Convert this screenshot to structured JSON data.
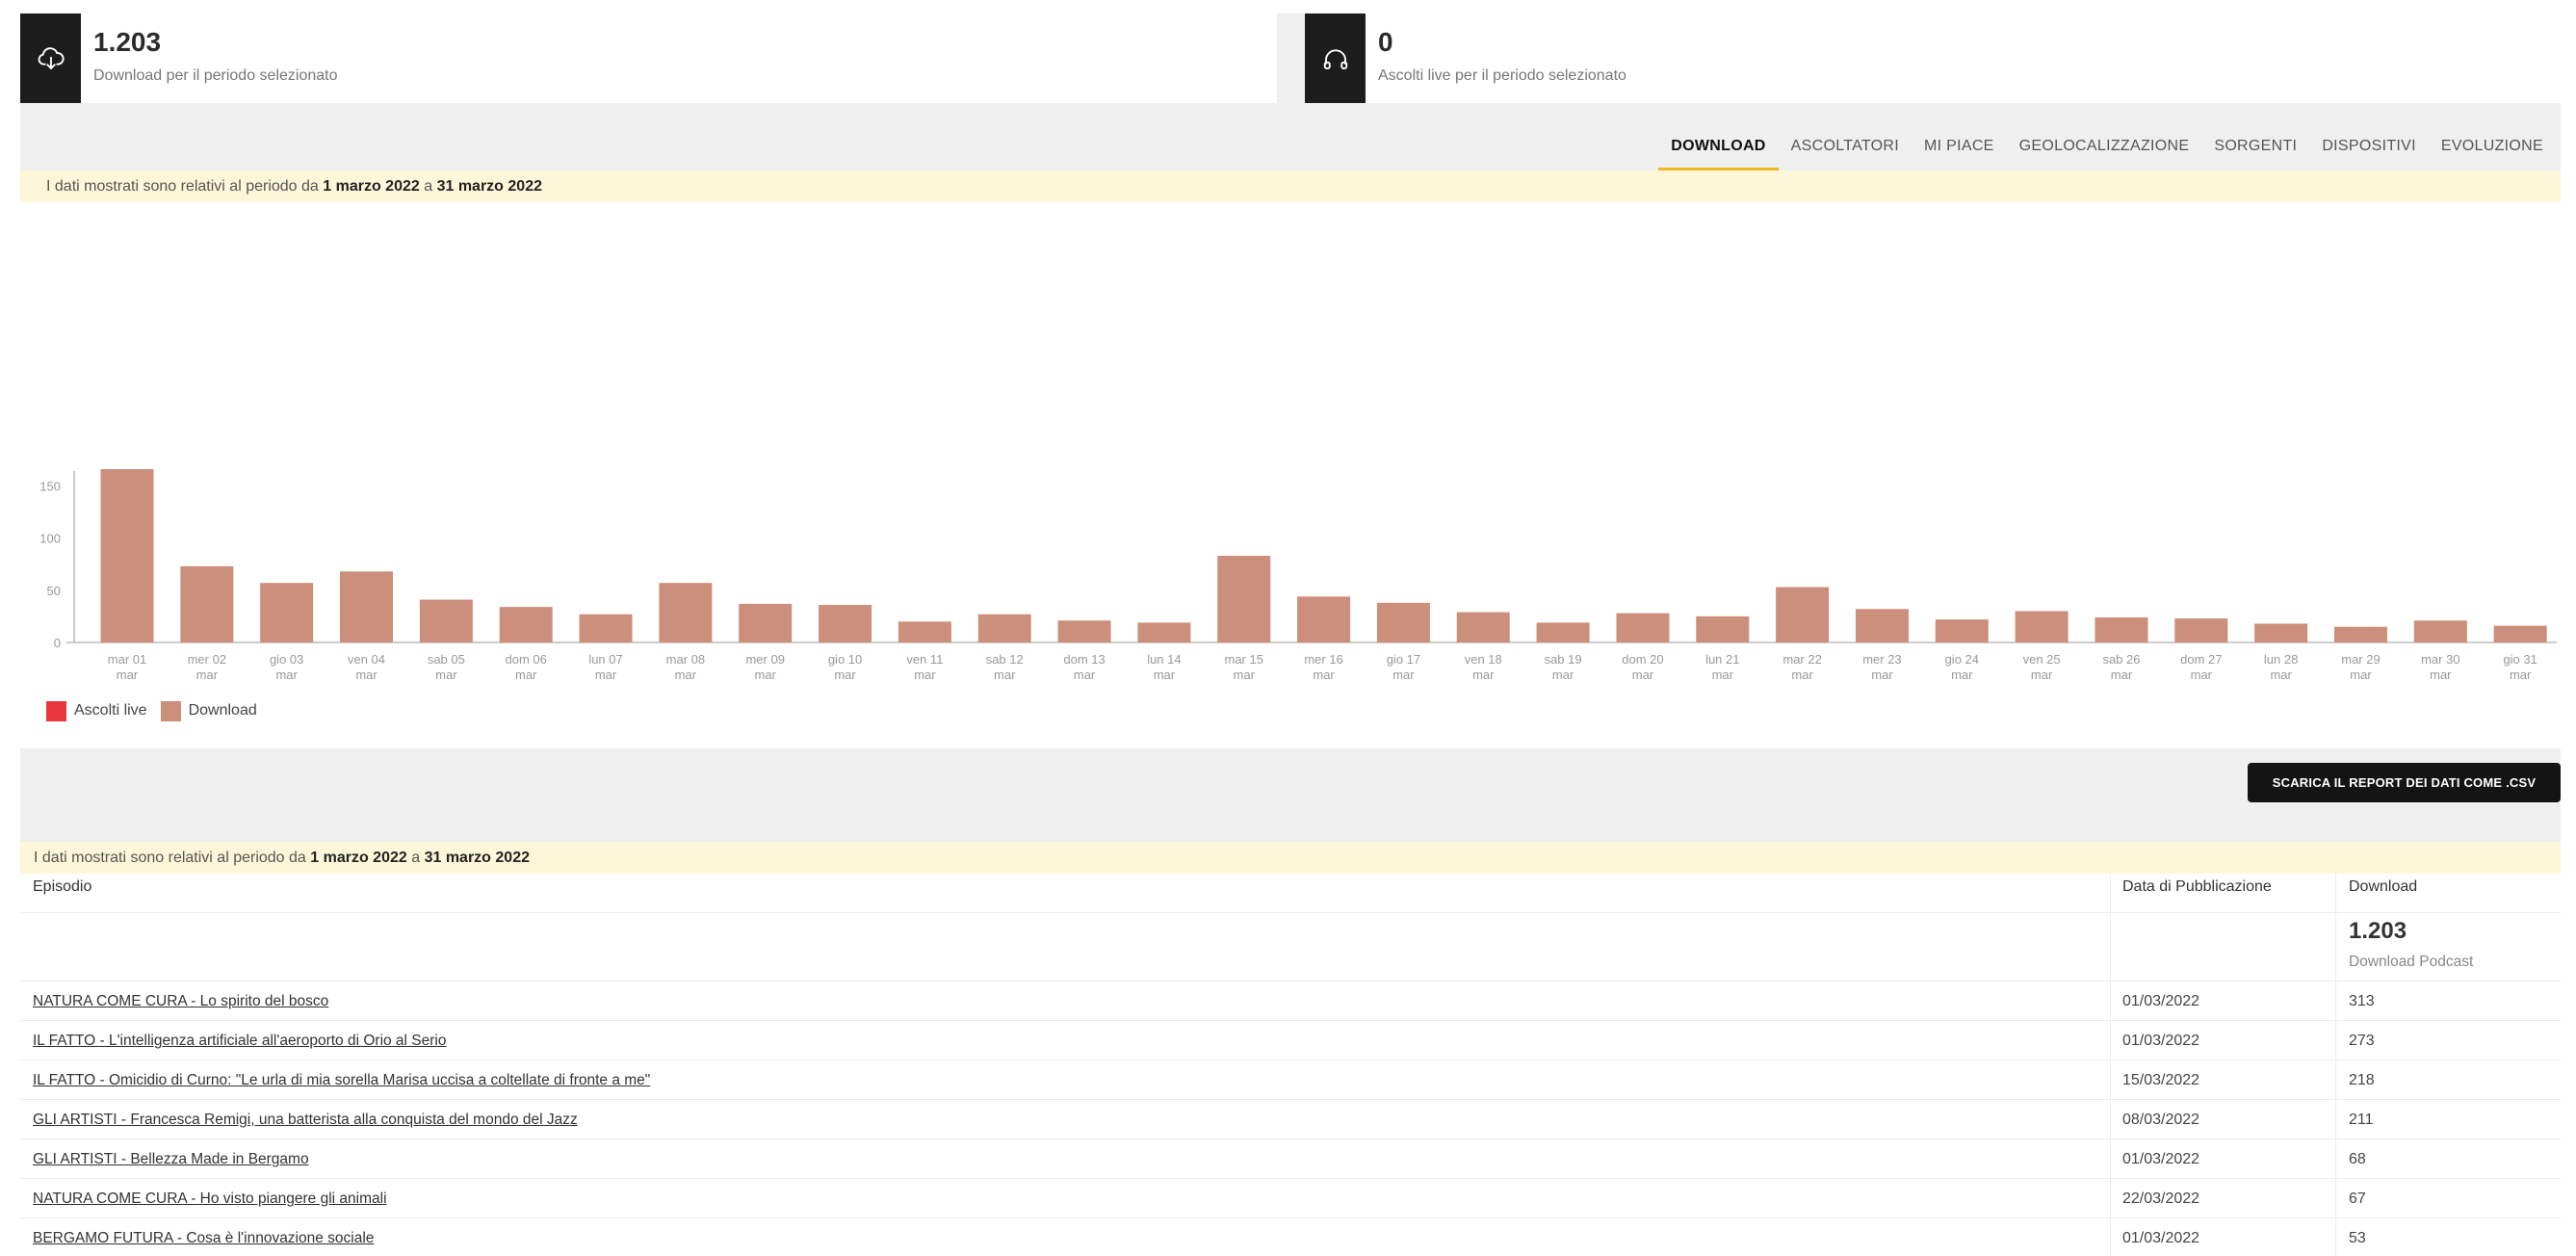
{
  "stats": {
    "downloads": {
      "value": "1.203",
      "label": "Download per il periodo selezionato",
      "icon": "cloud-download-icon"
    },
    "live": {
      "value": "0",
      "label": "Ascolti live per il periodo selezionato",
      "icon": "headphones-icon"
    }
  },
  "tabs": [
    {
      "label": "DOWNLOAD",
      "active": true
    },
    {
      "label": "ASCOLTATORI",
      "active": false
    },
    {
      "label": "MI PIACE",
      "active": false
    },
    {
      "label": "GEOLOCALIZZAZIONE",
      "active": false
    },
    {
      "label": "SORGENTI",
      "active": false
    },
    {
      "label": "DISPOSITIVI",
      "active": false
    },
    {
      "label": "EVOLUZIONE",
      "active": false
    }
  ],
  "notice": {
    "prefix": "I dati mostrati sono relativi al periodo da ",
    "from": "1 marzo 2022",
    "middle": " a ",
    "to": "31 marzo 2022"
  },
  "chart_data": {
    "type": "bar",
    "categories": [
      "mar 01",
      "mer 02",
      "gio 03",
      "ven 04",
      "sab 05",
      "dom 06",
      "lun 07",
      "mar 08",
      "mer 09",
      "gio 10",
      "ven 11",
      "sab 12",
      "dom 13",
      "lun 14",
      "mar 15",
      "mer 16",
      "gio 17",
      "ven 18",
      "sab 19",
      "dom 20",
      "lun 21",
      "mar 22",
      "mer 23",
      "gio 24",
      "ven 25",
      "sab 26",
      "dom 27",
      "lun 28",
      "mar 29",
      "mar 30",
      "gio 31"
    ],
    "category_sublabel": "mar",
    "series": [
      {
        "name": "Ascolti live",
        "color": "#e8383d",
        "values": [
          0,
          0,
          0,
          0,
          0,
          0,
          0,
          0,
          0,
          0,
          0,
          0,
          0,
          0,
          0,
          0,
          0,
          0,
          0,
          0,
          0,
          0,
          0,
          0,
          0,
          0,
          0,
          0,
          0,
          0,
          0
        ]
      },
      {
        "name": "Download",
        "color": "#cc8f7b",
        "values": [
          166,
          73,
          57,
          68,
          41,
          34,
          27,
          57,
          37,
          36,
          20,
          27,
          21,
          19,
          83,
          44,
          38,
          29,
          19,
          28,
          25,
          53,
          32,
          22,
          30,
          24,
          23,
          18,
          15,
          21,
          16
        ]
      }
    ],
    "yticks": [
      0,
      50,
      100,
      150
    ],
    "ylim": [
      0,
      190
    ],
    "legend": "bottom-left"
  },
  "csv_button": "SCARICA IL REPORT DEI DATI COME .CSV",
  "table": {
    "headers": {
      "episode": "Episodio",
      "date": "Data di Pubblicazione",
      "downloads": "Download"
    },
    "total": {
      "value": "1.203",
      "label": "Download Podcast"
    },
    "rows": [
      {
        "episode": "NATURA COME CURA - Lo spirito del bosco",
        "date": "01/03/2022",
        "downloads": "313"
      },
      {
        "episode": "IL FATTO - L'intelligenza artificiale all'aeroporto di Orio al Serio",
        "date": "01/03/2022",
        "downloads": "273"
      },
      {
        "episode": "IL FATTO - Omicidio di Curno: \"Le urla di mia sorella Marisa uccisa a coltellate di fronte a me\"",
        "date": "15/03/2022",
        "downloads": "218"
      },
      {
        "episode": "GLI ARTISTI - Francesca Remigi, una batterista alla conquista del mondo del Jazz",
        "date": "08/03/2022",
        "downloads": "211"
      },
      {
        "episode": "GLI ARTISTI - Bellezza Made in Bergamo",
        "date": "01/03/2022",
        "downloads": "68"
      },
      {
        "episode": "NATURA COME CURA - Ho visto piangere gli animali",
        "date": "22/03/2022",
        "downloads": "67"
      },
      {
        "episode": "BERGAMO FUTURA - Cosa è l'innovazione sociale",
        "date": "01/03/2022",
        "downloads": "53"
      }
    ]
  }
}
